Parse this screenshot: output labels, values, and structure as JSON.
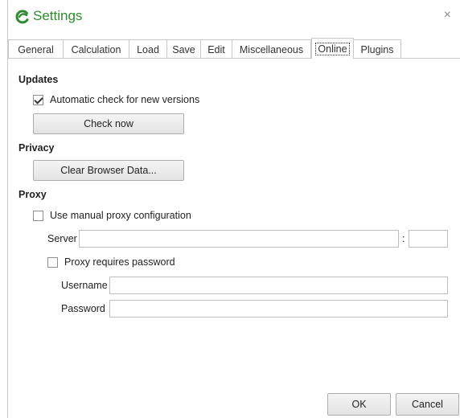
{
  "window": {
    "title": "Settings",
    "close_symbol": "×",
    "logo_icon": "geogebra-style-logo",
    "accent_color": "#2e8a2e"
  },
  "tabs": [
    {
      "label": "General"
    },
    {
      "label": "Calculation"
    },
    {
      "label": "Load"
    },
    {
      "label": "Save"
    },
    {
      "label": "Edit"
    },
    {
      "label": "Miscellaneous"
    },
    {
      "label": "Online",
      "active": true
    },
    {
      "label": "Plugins"
    }
  ],
  "updates": {
    "heading": "Updates",
    "auto_check_label": "Automatic check for new versions",
    "auto_check_checked": true,
    "check_now_label": "Check now"
  },
  "privacy": {
    "heading": "Privacy",
    "clear_label": "Clear Browser Data..."
  },
  "proxy": {
    "heading": "Proxy",
    "manual_label": "Use manual proxy configuration",
    "manual_checked": false,
    "server_label": "Server",
    "server_value": "",
    "port_separator": ":",
    "port_value": "",
    "requires_password_label": "Proxy requires password",
    "requires_password_checked": false,
    "username_label": "Username",
    "username_value": "",
    "password_label": "Password",
    "password_value": ""
  },
  "footer": {
    "ok_label": "OK",
    "cancel_label": "Cancel"
  }
}
